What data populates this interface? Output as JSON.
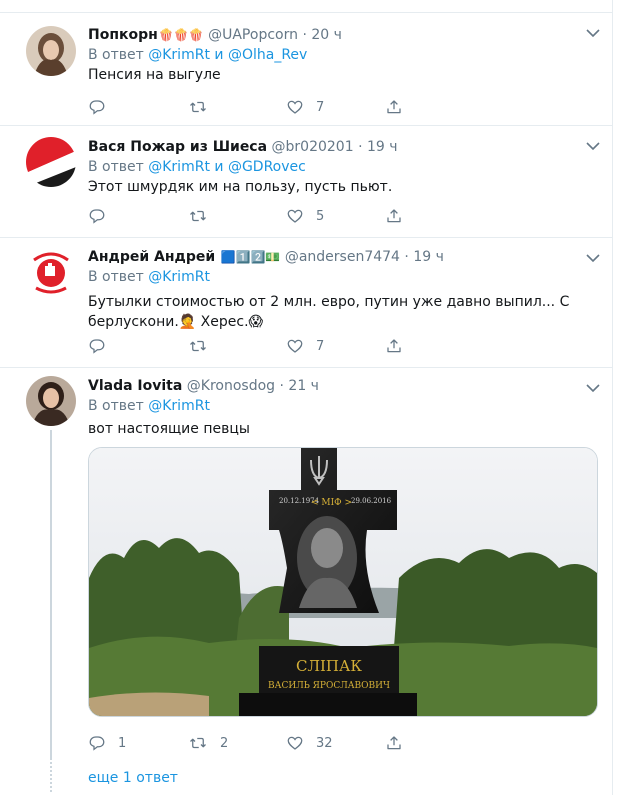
{
  "tweets": [
    {
      "name": "Попкорн",
      "emoji": "🍿🍿🍿",
      "handle": "@UAPopcorn",
      "dot": "·",
      "time": "20 ч",
      "reply_prefix": "В ответ",
      "reply_user1": "@KrimRt",
      "reply_and": "и",
      "reply_user2": "@Olha_Rev",
      "text": "Пенсия на выгуле",
      "reply_count": "",
      "retweet_count": "",
      "like_count": "7"
    },
    {
      "name": "Вася Пожар из Шиеса",
      "handle": "@br020201",
      "dot": "·",
      "time": "19 ч",
      "reply_prefix": "В ответ",
      "reply_user1": "@KrimRt",
      "reply_and": "и",
      "reply_user2": "@GDRovec",
      "text": "Этот шмурдяк им на пользу, пусть пьют.",
      "reply_count": "",
      "retweet_count": "",
      "like_count": "5"
    },
    {
      "name": "Андрей Андрей",
      "emoji": "🟦1️⃣2️⃣💵",
      "handle": "@andersen7474",
      "dot": "·",
      "time": "19 ч",
      "reply_prefix": "В ответ",
      "reply_user1": "@KrimRt",
      "text_line1": "Бутылки стоимостью от 2 млн. евро, путин уже давно выпил... С",
      "text_line2": "берлускони.🤦 Херес.😱",
      "reply_count": "",
      "retweet_count": "",
      "like_count": "7"
    },
    {
      "name": "Vlada Iovita",
      "handle": "@Kronosdog",
      "dot": "·",
      "time": "21 ч",
      "reply_prefix": "В ответ",
      "reply_user1": "@KrimRt",
      "text": "вот настоящие певцы",
      "reply_count": "1",
      "retweet_count": "2",
      "like_count": "32"
    }
  ],
  "photo": {
    "date_left": "20.12.1974",
    "date_right": "29.06.2016",
    "nickname": "< МІФ >",
    "surname": "СЛІПАК",
    "full_name": "ВАСИЛЬ ЯРОСЛАВОВИЧ"
  },
  "more_replies": "еще 1 ответ",
  "icons": {
    "reply": "reply-icon",
    "retweet": "retweet-icon",
    "like": "like-icon",
    "share": "share-icon",
    "menu": "chevron-down-icon"
  },
  "colors": {
    "link": "#1b95e0",
    "muted": "#657786",
    "border": "#e6ecf0"
  }
}
